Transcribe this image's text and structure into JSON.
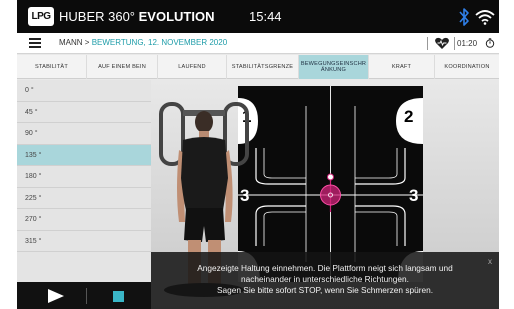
{
  "header": {
    "logo": "LPG",
    "product_prefix": "HUBER 360°",
    "product_name": "EVOLUTION",
    "time": "15:44"
  },
  "breadcrumb": {
    "patient": "MANN",
    "separator": ">",
    "session": "BEWERTUNG, 12. NOVEMBER 2020",
    "timer": "01:20"
  },
  "tabs": [
    {
      "label": "STABILITÄT",
      "active": false
    },
    {
      "label": "AUF EINEM BEIN",
      "active": false
    },
    {
      "label": "LAUFEND",
      "active": false
    },
    {
      "label": "STABILITÄTSGRENZE",
      "active": false
    },
    {
      "label": "BEWEGUNGSEINSCHRÄNKUNG",
      "label_line1": "BEWEGUNGSEINSCHR",
      "label_line2": "ÄNKUNG",
      "active": true
    },
    {
      "label": "KRAFT",
      "active": false
    },
    {
      "label": "KOORDINATION",
      "active": false
    }
  ],
  "angles": [
    {
      "label": "0 °",
      "active": false
    },
    {
      "label": "45 °",
      "active": false
    },
    {
      "label": "90 °",
      "active": false
    },
    {
      "label": "135 °",
      "active": true
    },
    {
      "label": "180 °",
      "active": false
    },
    {
      "label": "225 °",
      "active": false
    },
    {
      "label": "270 °",
      "active": false
    },
    {
      "label": "315 °",
      "active": false
    }
  ],
  "platform": {
    "quadrant_labels": [
      "1",
      "2",
      "3",
      "3"
    ],
    "accent_color": "#d0237a"
  },
  "message": {
    "close": "x",
    "line1": "Angezeigte Haltung einnehmen. Die Plattform neigt sich langsam und",
    "line2": "nacheinander in unterschiedliche Richtungen.",
    "line3": "Sagen Sie bitte sofort STOP, wenn Sie Schmerzen spüren."
  },
  "colors": {
    "accent": "#a9d6db",
    "breadcrumb_highlight": "#1d9ca8",
    "stop_button": "#3ab6c7"
  },
  "icons": [
    "menu-icon",
    "bluetooth-icon",
    "wifi-icon",
    "heart-icon",
    "timer-icon",
    "play-icon",
    "stop-icon"
  ]
}
